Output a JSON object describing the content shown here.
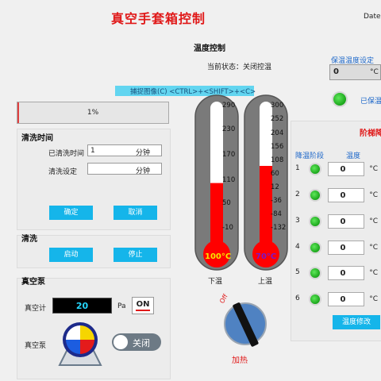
{
  "header": {
    "title": "真空手套箱控制",
    "date_label": "Date:"
  },
  "progress": {
    "percent_text": "1%",
    "fraction": 0.01
  },
  "wash_time": {
    "title": "清洗时间",
    "cleared_label": "已清洗时间",
    "cleared_value": "1",
    "cleared_unit": "分钟",
    "setting_label": "清洗设定",
    "setting_value": "",
    "setting_unit": "分钟",
    "confirm": "确定",
    "cancel": "取消"
  },
  "wash": {
    "title": "清洗",
    "start": "启动",
    "stop": "停止"
  },
  "vacuum": {
    "title": "真空泵",
    "gauge_label": "真空计",
    "gauge_value": "20",
    "gauge_unit": "Pa",
    "on_label": "ON",
    "pump_label": "真空泵",
    "toggle_label": "关闭"
  },
  "temp": {
    "title": "温度控制",
    "state_label": "当前状态：",
    "state_value": "关闭控温",
    "capture_tip": "捕捉图像(C)   <CTRL>+<SHIFT>+<C>",
    "hold_title": "保温温度设定",
    "hold_value": "0",
    "hold_unit": "°C",
    "hold_status": "已保温",
    "lower": {
      "label": "下温",
      "reading": "100°C",
      "ticks": [
        "290",
        "230",
        "170",
        "110",
        "50",
        "-10"
      ],
      "fill_fraction": 0.43
    },
    "upper": {
      "label": "上温",
      "reading": "70°C",
      "ticks": [
        "300",
        "252",
        "204",
        "156",
        "108",
        "60",
        "12",
        "-36",
        "-84",
        "-132"
      ],
      "fill_fraction": 0.55
    },
    "knob_off": "Off",
    "knob_label": "加热"
  },
  "stage": {
    "title": "阶梯降",
    "col_stage": "降温阶段",
    "col_temp": "温度",
    "rows": [
      {
        "n": "1",
        "value": "0",
        "unit": "°C"
      },
      {
        "n": "2",
        "value": "0",
        "unit": "°C"
      },
      {
        "n": "3",
        "value": "0",
        "unit": "°C"
      },
      {
        "n": "4",
        "value": "0",
        "unit": "°C"
      },
      {
        "n": "5",
        "value": "0",
        "unit": "°C"
      },
      {
        "n": "6",
        "value": "0",
        "unit": "°C"
      }
    ],
    "modify": "温度修改"
  },
  "colors": {
    "accent": "#15b5ea",
    "title_red": "#e01818",
    "led_green": "#2bc32b",
    "mercury": "#ff0000"
  }
}
